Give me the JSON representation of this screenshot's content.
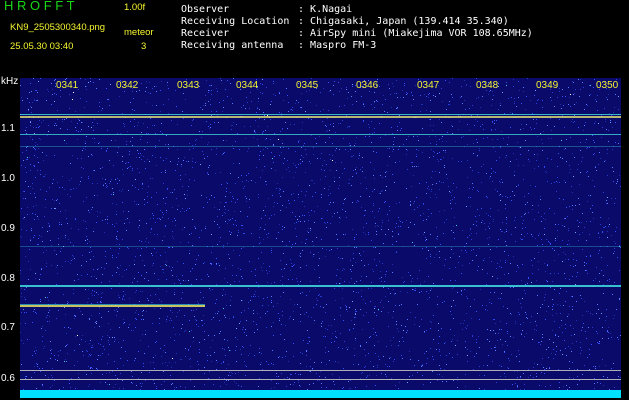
{
  "header": {
    "logo": "H R O F F T",
    "version": "1.00f",
    "filename": "KN9_2505300340.png",
    "timestamp": "25.05.30 03:40",
    "meteor_label": "meteor",
    "meteor_count": "3"
  },
  "station": [
    {
      "label": "Observer",
      "value": "K.Nagai"
    },
    {
      "label": "Receiving Location",
      "value": "Chigasaki, Japan (139.414 35.340)"
    },
    {
      "label": "Receiver",
      "value": "AirSpy mini (Miakejima VOR 108.65MHz)"
    },
    {
      "label": "Receiving antenna",
      "value": "Maspro FM-3"
    }
  ],
  "axis": {
    "unit": "kHz",
    "y_ticks": [
      "1.1",
      "1.0",
      "0.9",
      "0.8",
      "0.7",
      "0.6"
    ],
    "x_ticks": [
      "0341",
      "0342",
      "0343",
      "0344",
      "0345",
      "0346",
      "0347",
      "0348",
      "0349",
      "0350"
    ]
  },
  "colors": {
    "background": "#000000",
    "spectrum_base": "#0a0a6a",
    "noise_speckle": "#4a6cff",
    "signal_line": "#40e0e0",
    "tick_label": "#f4f430",
    "logo_green": "#19d619"
  }
}
